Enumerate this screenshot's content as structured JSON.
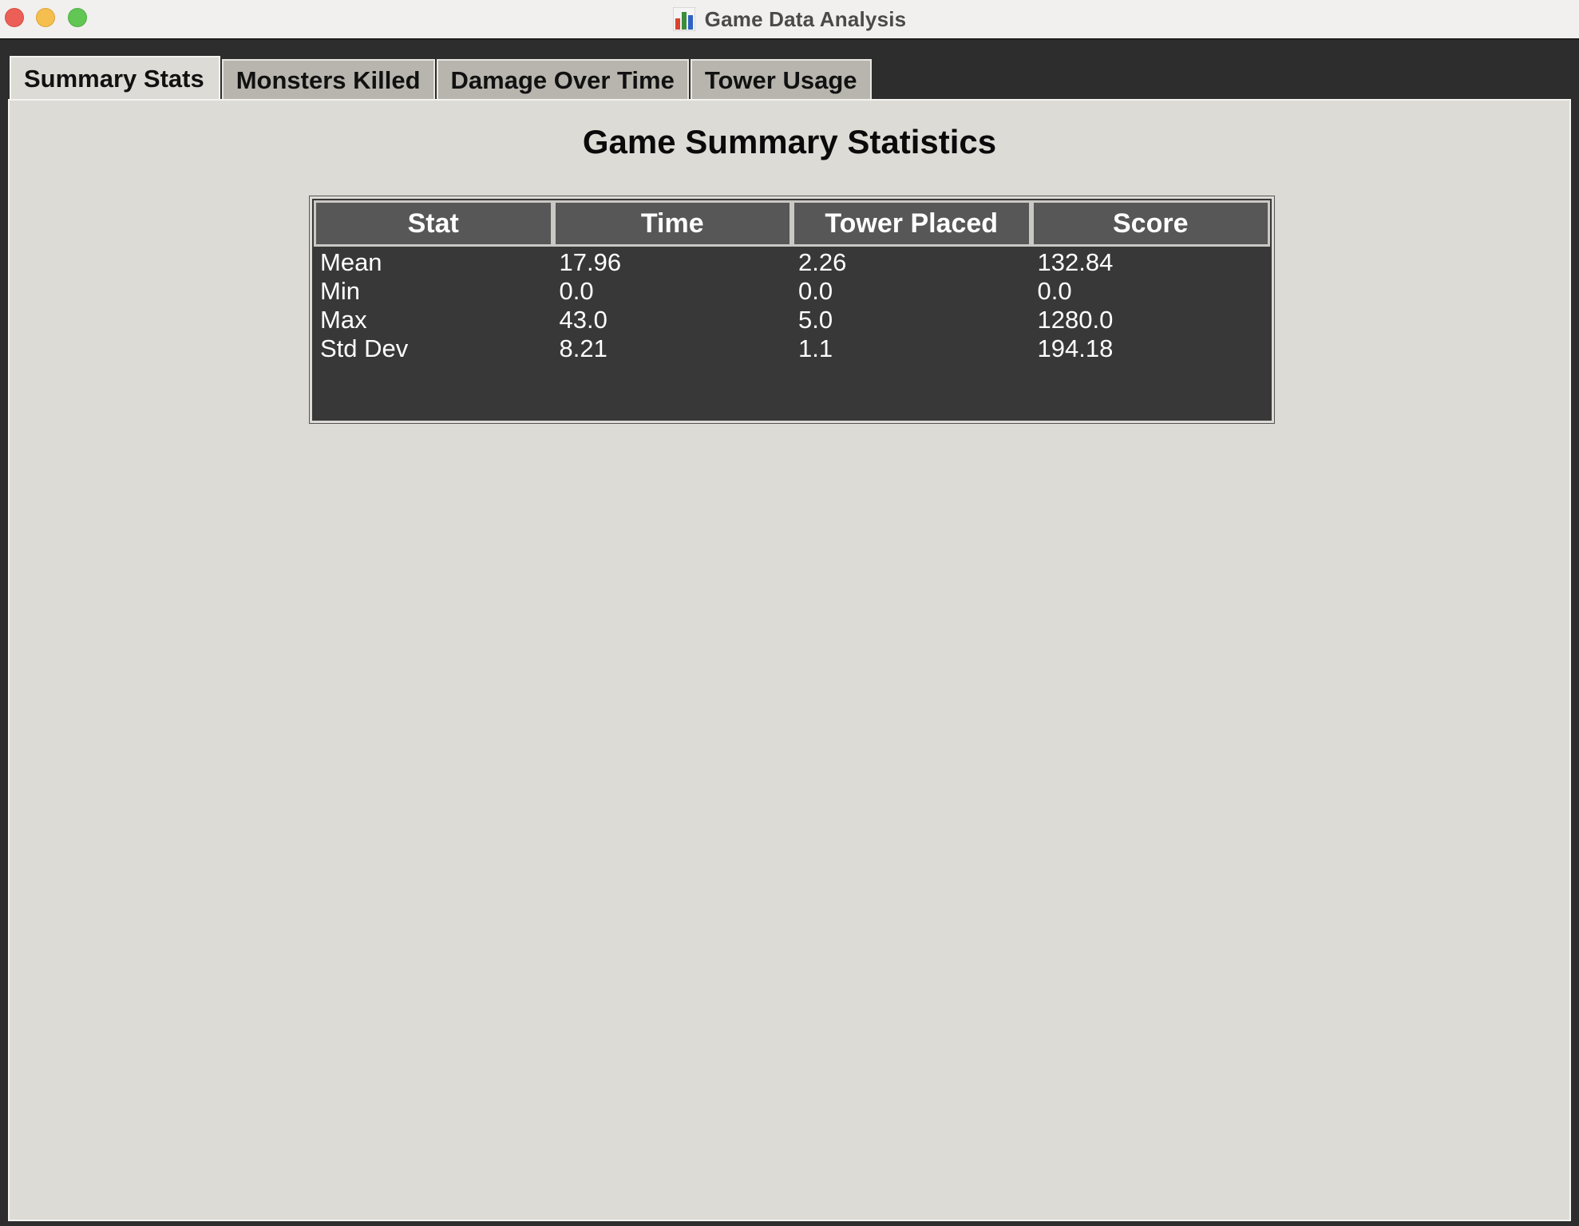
{
  "window": {
    "title": "Game Data Analysis",
    "title_icon": "bar-chart-icon"
  },
  "tabs": [
    {
      "label": "Summary Stats",
      "active": true
    },
    {
      "label": "Monsters Killed",
      "active": false
    },
    {
      "label": "Damage Over Time",
      "active": false
    },
    {
      "label": "Tower Usage",
      "active": false
    }
  ],
  "panel": {
    "title": "Game Summary Statistics"
  },
  "table": {
    "columns": [
      "Stat",
      "Time",
      "Tower Placed",
      "Score"
    ],
    "rows": [
      [
        "Mean",
        "17.96",
        "2.26",
        "132.84"
      ],
      [
        "Min",
        "0.0",
        "0.0",
        "0.0"
      ],
      [
        "Max",
        "43.0",
        "5.0",
        "1280.0"
      ],
      [
        "Std Dev",
        "8.21",
        "1.1",
        "194.18"
      ]
    ]
  },
  "colors": {
    "window_bg": "#2d2d2d",
    "panel_bg": "#dcdbd6",
    "table_bg": "#383838",
    "header_bg": "#575757"
  }
}
